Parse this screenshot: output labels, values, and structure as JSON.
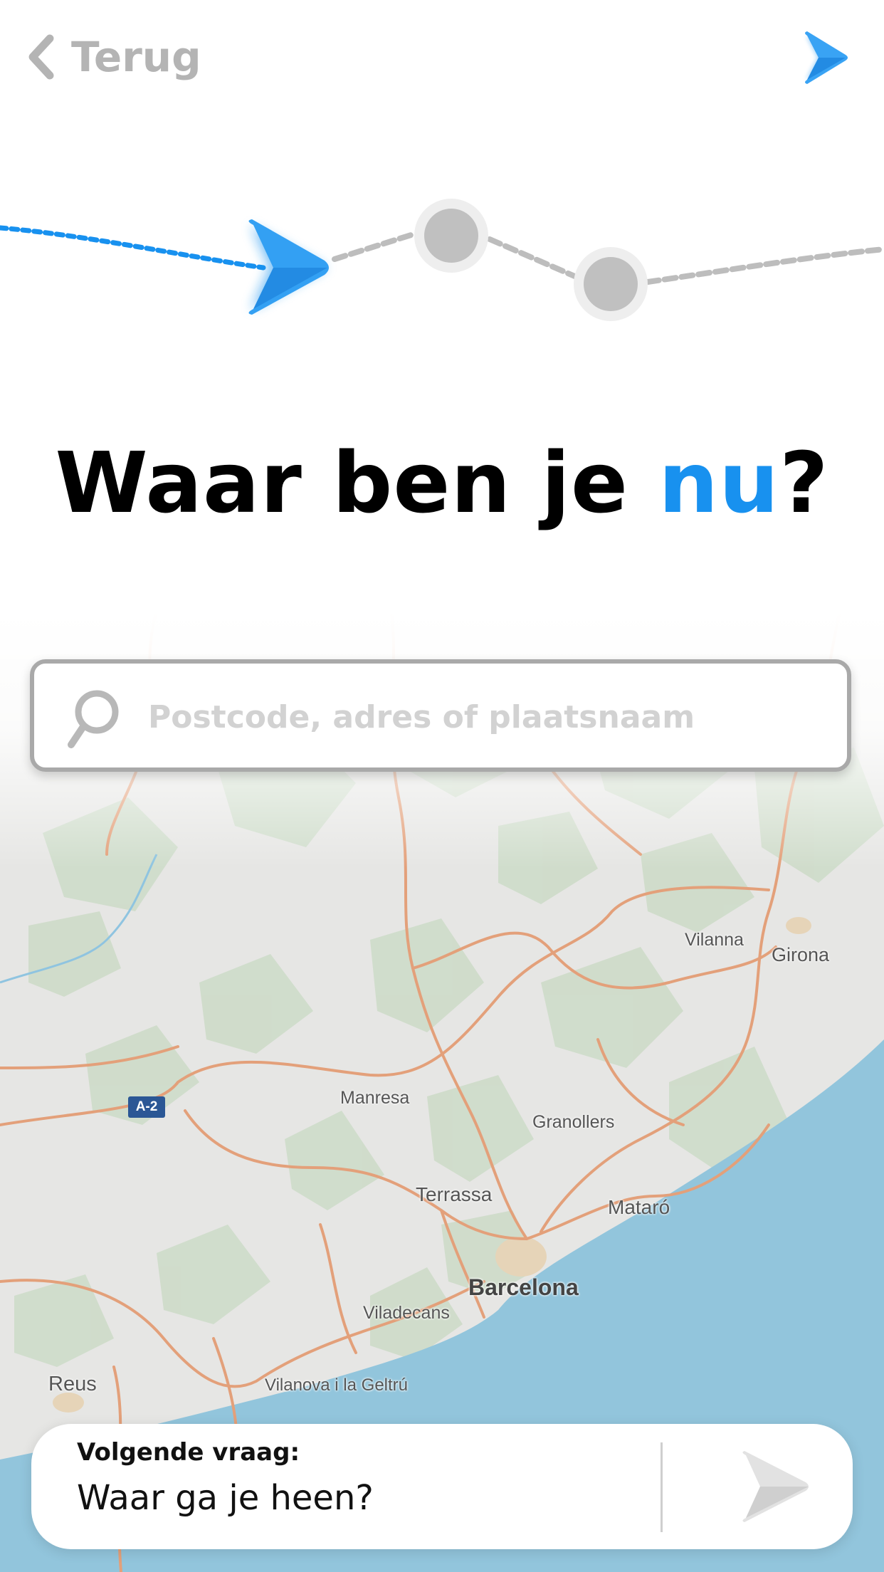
{
  "topbar": {
    "back_label": "Terug",
    "back_icon": "chevron-left-icon",
    "logo_icon": "brand-arrow-icon"
  },
  "progress": {
    "current_step": 1,
    "total_steps": 3,
    "active_color": "#1891ef",
    "inactive_color": "#bdbdbd"
  },
  "title": {
    "prefix": "Waar ben je ",
    "accent": "nu",
    "suffix": "?"
  },
  "search": {
    "placeholder": "Postcode, adres of plaatsnaam",
    "value": "",
    "icon": "search-icon"
  },
  "map": {
    "labels": {
      "vilanna": "Vilanna",
      "girona": "Girona",
      "manresa": "Manresa",
      "granollers": "Granollers",
      "terrassa": "Terrassa",
      "mataro": "Mataró",
      "barcelona": "Barcelona",
      "viladecans": "Viladecans",
      "reus": "Reus",
      "vilanova": "Vilanova i la Geltrú",
      "road": "A-2"
    },
    "colors": {
      "land": "#e6e6e4",
      "sea": "#92c5dc",
      "forest": "#cfdccb",
      "road": "#e3a07a"
    }
  },
  "next": {
    "label": "Volgende vraag:",
    "question": "Waar ga je heen?",
    "button_icon": "next-arrow-icon"
  }
}
